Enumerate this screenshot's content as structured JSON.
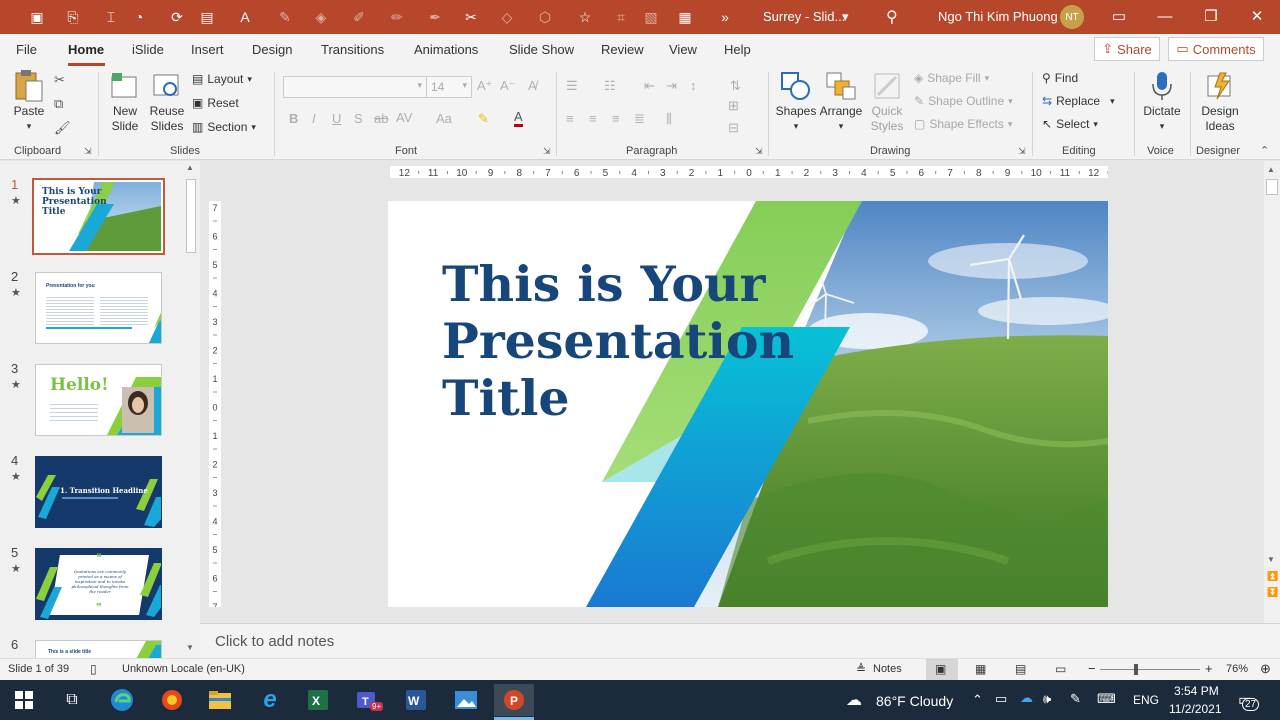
{
  "titlebar": {
    "title": "Surrey - Slid...",
    "user": "Ngo Thi Kim Phuong",
    "initials": "NT",
    "accent": "#b7472a"
  },
  "tabs": {
    "file": "File",
    "home": "Home",
    "islide": "iSlide",
    "insert": "Insert",
    "design": "Design",
    "transitions": "Transitions",
    "animations": "Animations",
    "slideshow": "Slide Show",
    "review": "Review",
    "view": "View",
    "help": "Help",
    "share": "Share",
    "comments": "Comments"
  },
  "ribbon": {
    "clipboard": {
      "label": "Clipboard",
      "paste": "Paste"
    },
    "slides": {
      "label": "Slides",
      "new_slide_1": "New",
      "new_slide_2": "Slide",
      "reuse_1": "Reuse",
      "reuse_2": "Slides",
      "layout": "Layout",
      "reset": "Reset",
      "section": "Section"
    },
    "font": {
      "label": "Font",
      "size": "14"
    },
    "paragraph": {
      "label": "Paragraph"
    },
    "drawing": {
      "label": "Drawing",
      "shapes": "Shapes",
      "arrange": "Arrange",
      "quick_1": "Quick",
      "quick_2": "Styles",
      "shape_fill": "Shape Fill",
      "shape_outline": "Shape Outline",
      "shape_effects": "Shape Effects"
    },
    "editing": {
      "label": "Editing",
      "find": "Find",
      "replace": "Replace",
      "select": "Select"
    },
    "voice": {
      "label": "Voice",
      "dictate": "Dictate"
    },
    "designer": {
      "label": "Designer",
      "ideas_1": "Design",
      "ideas_2": "Ideas"
    }
  },
  "thumbnails": [
    {
      "num": "1",
      "title_1": "This is Your",
      "title_2": "Presentation",
      "title_3": "Title"
    },
    {
      "num": "2",
      "title": "Presentation for you"
    },
    {
      "num": "3",
      "title": "Hello!"
    },
    {
      "num": "4",
      "title": "1. Transition Headline"
    },
    {
      "num": "5",
      "title": "Quotations are commonly printed as a means of inspiration and to invoke philosophical thoughts from the reader"
    },
    {
      "num": "6",
      "title": "This is a slide title"
    }
  ],
  "ruler": {
    "h_ticks": [
      "12",
      "11",
      "10",
      "9",
      "8",
      "7",
      "6",
      "5",
      "4",
      "3",
      "2",
      "1",
      "0",
      "1",
      "2",
      "3",
      "4",
      "5",
      "6",
      "7",
      "8",
      "9",
      "10",
      "11",
      "12"
    ]
  },
  "slide": {
    "title_1": "This is Your",
    "title_2": "Presentation",
    "title_3": "Title",
    "title_color": "#17467a"
  },
  "notes": {
    "placeholder": "Click to add notes"
  },
  "status": {
    "slide_info": "Slide 1 of 39",
    "locale": "Unknown Locale (en-UK)",
    "notes": "Notes",
    "zoom": "76%"
  },
  "taskbar": {
    "weather": "86°F  Cloudy",
    "lang": "ENG",
    "time": "3:54 PM",
    "date": "11/2/2021",
    "notif_count": "27",
    "teams_badge": "9+"
  }
}
